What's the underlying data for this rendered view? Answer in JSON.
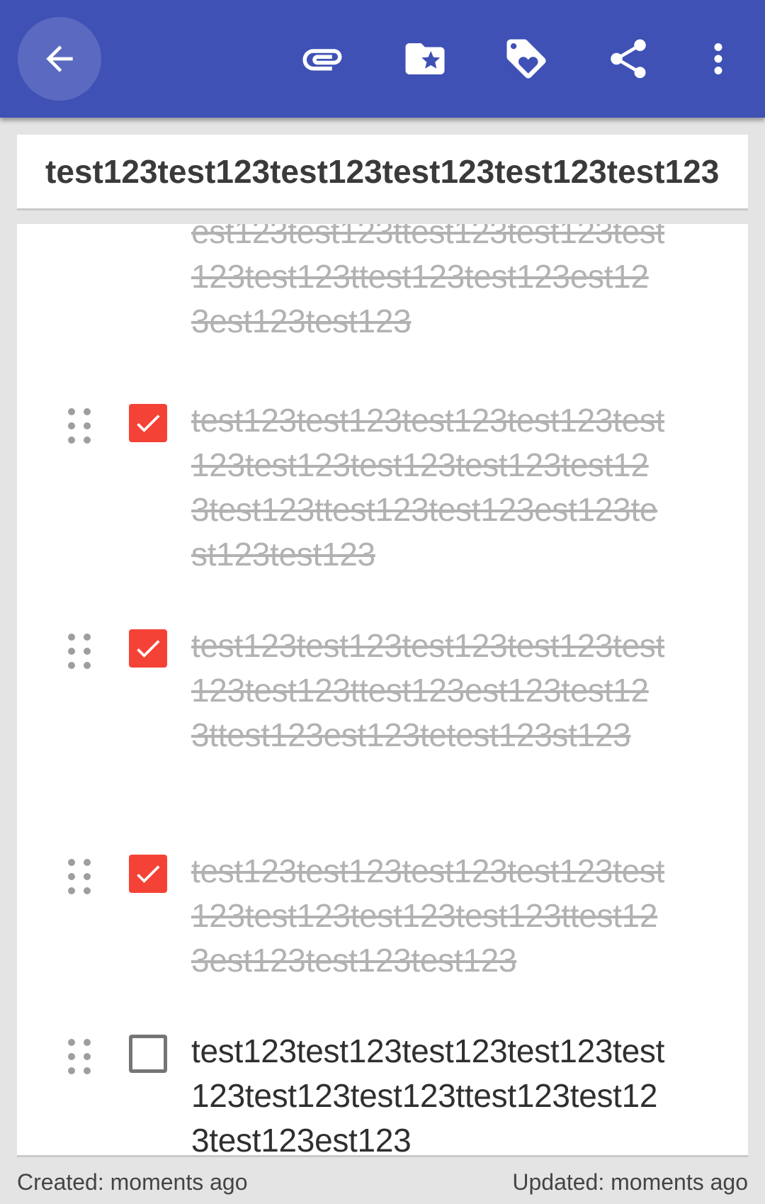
{
  "toolbar": {
    "back_icon": "arrow-left-icon",
    "icons": [
      "paperclip-icon",
      "folder-star-icon",
      "tag-heart-icon",
      "share-icon",
      "more-vert-icon"
    ],
    "color": "#3f51b5"
  },
  "note": {
    "title": "test123test123test123test123test123test123"
  },
  "checklist": {
    "accent": "#f44336",
    "items": [
      {
        "text": "est123test123ttest123test123test123test123ttest123test123est123est123test123",
        "checked": true
      },
      {
        "text": "test123test123test123test123test123test123test123test123test123test123ttest123test123est123test123test123",
        "checked": true
      },
      {
        "text": "test123test123test123test123test123test123ttest123est123test123ttest123est123tetest123st123",
        "checked": true
      },
      {
        "text": "test123test123test123test123test123test123test123test123ttest123est123test123test123",
        "checked": true
      },
      {
        "text": "test123test123test123test123test123test123test123ttest123test123test123est123",
        "checked": false
      }
    ]
  },
  "footer": {
    "created": "Created: moments ago",
    "updated": "Updated: moments ago"
  }
}
